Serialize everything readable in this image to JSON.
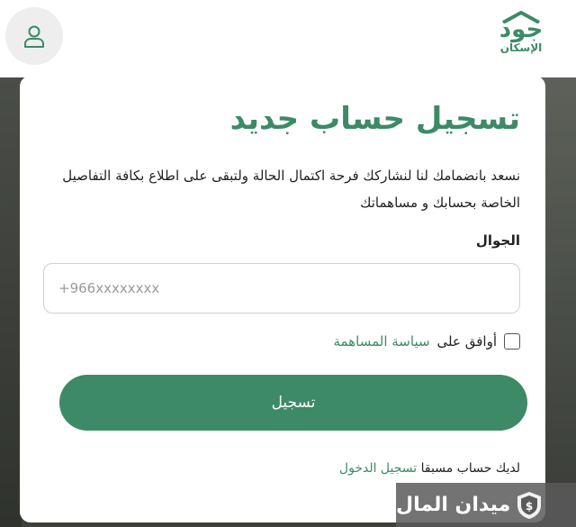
{
  "header": {
    "logo": {
      "main_text": "جود",
      "sub_text": "الإسكان"
    },
    "user_icon": "user-icon"
  },
  "form": {
    "title": "تسجيل حساب جديد",
    "description": "نسعد بانضمامك لنا لنشاركك فرحة اكتمال الحالة ولتبقى على اطلاع بكافة التفاصيل الخاصة بحسابك و مساهماتك",
    "phone_label": "الجوال",
    "phone_placeholder": "+966xxxxxxxx",
    "phone_value": "",
    "agree_text": "أوافق على",
    "policy_link": "سياسة المساهمة",
    "submit_label": "تسجيل",
    "login_prompt": "لديك حساب مسبقا",
    "login_link": "تسجيل الدخول"
  },
  "watermark": {
    "text": "ميدان المال",
    "icon": "shield-dollar-icon"
  },
  "colors": {
    "brand_green": "#3d8a67",
    "text_dark": "#222222",
    "placeholder": "#9a9a9a"
  }
}
